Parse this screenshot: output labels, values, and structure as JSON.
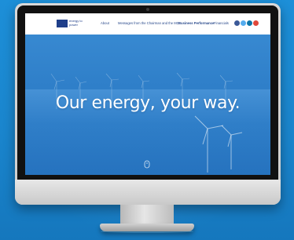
{
  "site": {
    "logo_text": "energy to power",
    "nav": [
      {
        "label": "About"
      },
      {
        "label": "Messages from the Chairman and the MD"
      },
      {
        "label": "Business Performance"
      },
      {
        "label": "Financials"
      }
    ],
    "social_icons": [
      {
        "name": "facebook-icon",
        "color": "#3b5998"
      },
      {
        "name": "twitter-icon",
        "color": "#55acee"
      },
      {
        "name": "linkedin-icon",
        "color": "#0e76a8"
      },
      {
        "name": "youtube-icon",
        "color": "#e0483a"
      }
    ]
  },
  "hero": {
    "headline": "Our energy, your way.",
    "scroll_icon": "mouse-scroll-icon"
  },
  "colors": {
    "background": "#1d8fd8",
    "brand": "#1f3f8a",
    "hero_blue": "#3b8dd4"
  }
}
